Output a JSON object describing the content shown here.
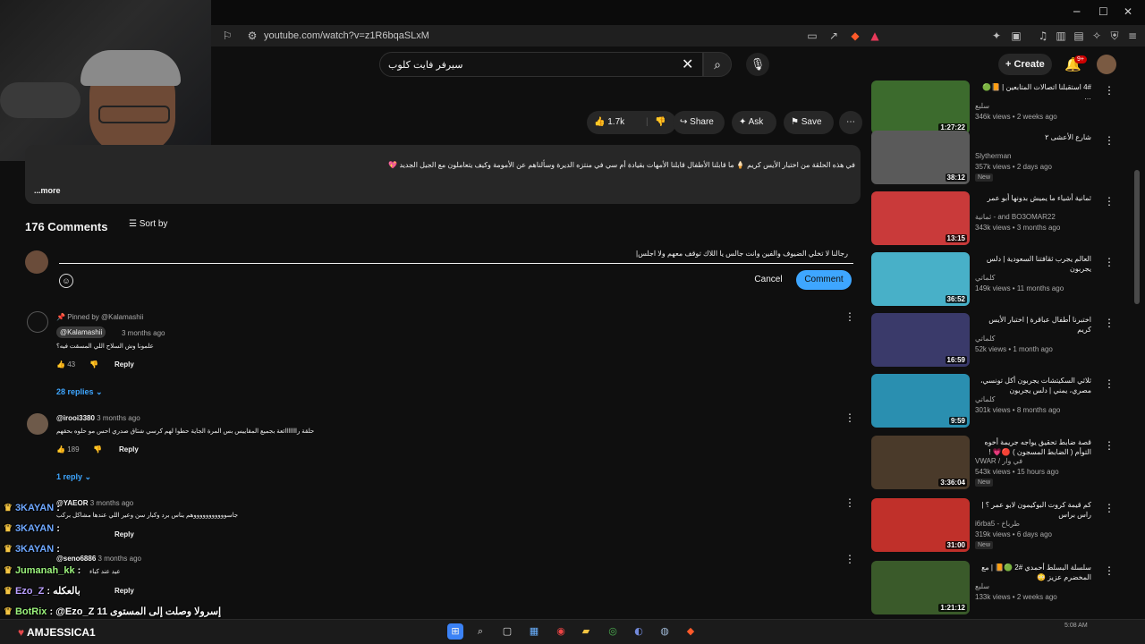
{
  "browser": {
    "url": "youtube.com/watch?v=z1R6bqaSLxM",
    "window_controls": {
      "minimize": "─",
      "maximize": "☐",
      "close": "✕"
    }
  },
  "youtube_header": {
    "search_value": "سيرفر فايت كلوب",
    "create_label": "Create",
    "notification_count": "9+"
  },
  "actions": {
    "likes": "1.7k",
    "share": "Share",
    "ask": "Ask",
    "save": "Save"
  },
  "description": {
    "text": "في هذه الحلقة من اختبار الأيس كريم 🍦 ما قابلنا الأطفال قابلنا الأمهات  بقيادة أم سي في منتزه الديرة وسألناهم عن الأمومة وكيف يتعاملون مع الجيل الجديد 💖",
    "more": "...more"
  },
  "comments": {
    "count_label": "176 Comments",
    "sort_label": "Sort by",
    "input_value": "رجالنا لا تخلي الضيوف والفين وانت جالس يا اللاك توقف معهم ولا اجلس|",
    "cancel": "Cancel",
    "comment": "Comment",
    "items": [
      {
        "pinned": "Pinned by @Kalamashii",
        "author": "@Kalamashii",
        "time": "3 months ago",
        "text": "علمونا وش السلاح اللي المسقت فيه؟",
        "likes": "43",
        "reply": "Reply",
        "replies": "28 replies"
      },
      {
        "author": "@irooi3380",
        "time": "3 months ago",
        "text": "حلقة رااااااائعة بجميع المقاييس بس المرة الجاية حطوا لهم كرسي شتاق صدري احس مو حلوه بحقهم",
        "likes": "189",
        "reply": "Reply",
        "replies": "1 reply"
      },
      {
        "author": "@YAEOR",
        "time": "3 months ago",
        "text": "جاسوووووووووووهم يناس برد وكبار سن وعير اللي عندها مشاكل بركب",
        "reply": "Reply"
      },
      {
        "author": "@seno6886",
        "time": "3 months ago",
        "text": "عيد عند كباء",
        "reply": "Reply"
      }
    ]
  },
  "recommendations": [
    {
      "title": "4# استقبلنا اتصالات المتابعين | 📙🟢 …",
      "channel": "سلبع",
      "stats": "346k views • 2 weeks ago",
      "duration": "1:27:22",
      "new": ""
    },
    {
      "title": "شارع الأعشى ٢",
      "channel": "Slytherman",
      "stats": "357k views • 2 days ago",
      "duration": "38:12",
      "new": "New"
    },
    {
      "title": "ثمانية أشياء ما يميش بدونها أبو عمر",
      "channel": "ثمانية - and BO3OMAR22",
      "stats": "343k views • 3 months ago",
      "duration": "13:15",
      "new": ""
    },
    {
      "title": "العالم يجرب ثقافتنا السعودية | دلس يجربون",
      "channel": "كلماتي",
      "stats": "149k views • 11 months ago",
      "duration": "36:52",
      "new": ""
    },
    {
      "title": "اختبرنا أطفال عباقرة | اختبار الأيس كريم",
      "channel": "كلماتي",
      "stats": "52k views • 1 month ago",
      "duration": "16:59",
      "new": ""
    },
    {
      "title": "ثلاثي السكيتشات يجربون أكل تونسي، مصري، يمني | دلس يجربون",
      "channel": "كلماتي",
      "stats": "301k views • 8 months ago",
      "duration": "9:59",
      "new": ""
    },
    {
      "title": "قصة ضابط تحقيق يواجه جريمة أخوه التوأم ( الضابط المسجون ) 🔴💗 !",
      "channel": "VWAR / في وار",
      "stats": "543k views • 15 hours ago",
      "duration": "3:36:04",
      "new": "New"
    },
    {
      "title": "كم قيمة كروت البوكيمون لابو عمر ؟ | راس براس",
      "channel": "i6rba5 - طرباخ",
      "stats": "319k views • 6 days ago",
      "duration": "31:00",
      "new": "New"
    },
    {
      "title": "سلسلة البسلط أحمدي #2 🟢📙 | مع المخضرم عزيز 😳",
      "channel": "سلبع",
      "stats": "133k views • 2 weeks ago",
      "duration": "1:21:12",
      "new": ""
    }
  ],
  "chat_overlay": [
    {
      "name": "3KAYAN",
      "msg": ":"
    },
    {
      "name": "3KAYAN",
      "msg": ":"
    },
    {
      "name": "3KAYAN",
      "msg": ":"
    },
    {
      "name": "Jumanah_kk",
      "msg": ":"
    },
    {
      "name": "Ezo_Z",
      "msg": ": بالعكله"
    },
    {
      "name": "BotRix",
      "msg": ": @Ezo_Z  إسرولا وصلت إلى المستوى 11"
    }
  ],
  "taskbar": {
    "streamer_name": "AMJESSICA1",
    "clock": "5:08 AM"
  }
}
